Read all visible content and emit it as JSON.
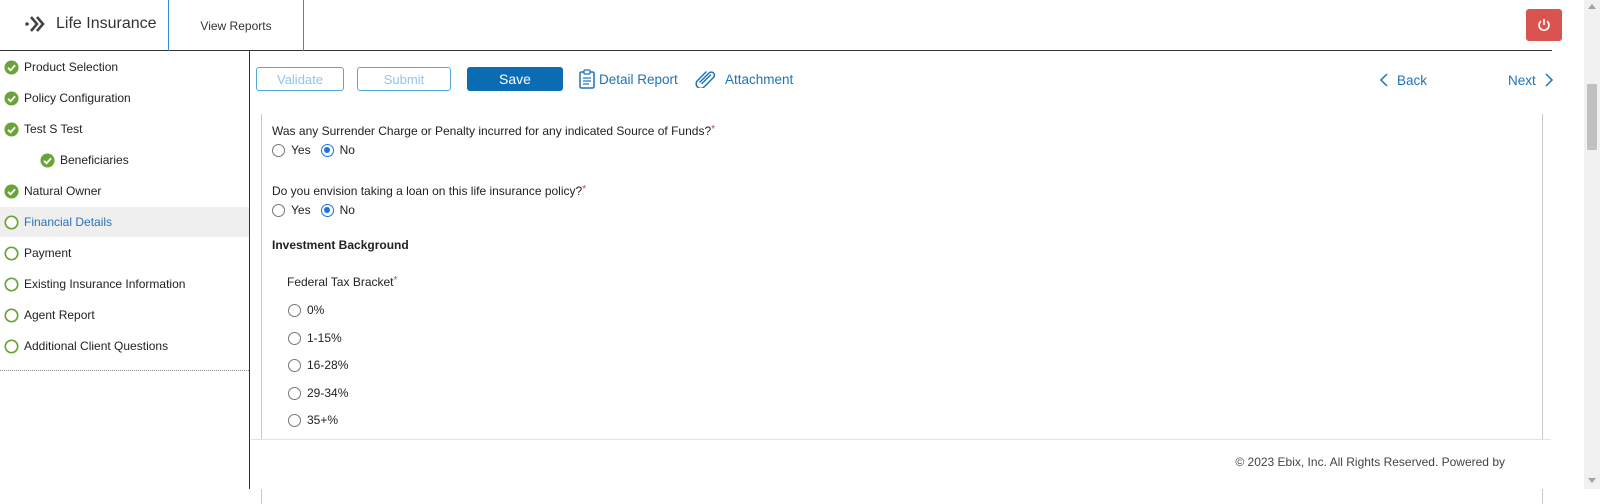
{
  "header": {
    "app_title": "Life Insurance",
    "tab_view_reports": "View Reports",
    "power_color": "#d9534f"
  },
  "sidebar": {
    "items": [
      {
        "label": "Product Selection",
        "status": "complete"
      },
      {
        "label": "Policy Configuration",
        "status": "complete"
      },
      {
        "label": "Test S Test",
        "status": "complete"
      },
      {
        "label": "Beneficiaries",
        "status": "complete",
        "sub": true
      },
      {
        "label": "Natural Owner",
        "status": "complete"
      },
      {
        "label": "Financial Details",
        "status": "incomplete",
        "active": true
      },
      {
        "label": "Payment",
        "status": "incomplete"
      },
      {
        "label": "Existing Insurance Information",
        "status": "incomplete"
      },
      {
        "label": "Agent Report",
        "status": "incomplete"
      },
      {
        "label": "Additional Client Questions",
        "status": "incomplete"
      }
    ]
  },
  "toolbar": {
    "validate_label": "Validate",
    "submit_label": "Submit",
    "save_label": "Save",
    "detail_report_label": "Detail Report",
    "attachment_label": "Attachment",
    "back_label": "Back",
    "next_label": "Next"
  },
  "form": {
    "q1": {
      "text": "Was any Surrender Charge or Penalty incurred for any indicated Source of Funds?",
      "required": "*",
      "options": [
        "Yes",
        "No"
      ],
      "selected": "No"
    },
    "q2": {
      "text": "Do you envision taking a loan on this life insurance policy?",
      "required": "*",
      "options": [
        "Yes",
        "No"
      ],
      "selected": "No"
    },
    "section_title": "Investment Background",
    "tax_bracket": {
      "label": "Federal Tax Bracket",
      "required": "*",
      "options": [
        "0%",
        "1-15%",
        "16-28%",
        "29-34%",
        "35+%"
      ]
    }
  },
  "footer": {
    "copyright": "© 2023 Ebix, Inc. All Rights Reserved. Powered by"
  },
  "colors": {
    "accent": "#0b6cb4",
    "link": "#1f73b7",
    "complete_green": "#6aa336",
    "required_red": "#d43c3c"
  }
}
